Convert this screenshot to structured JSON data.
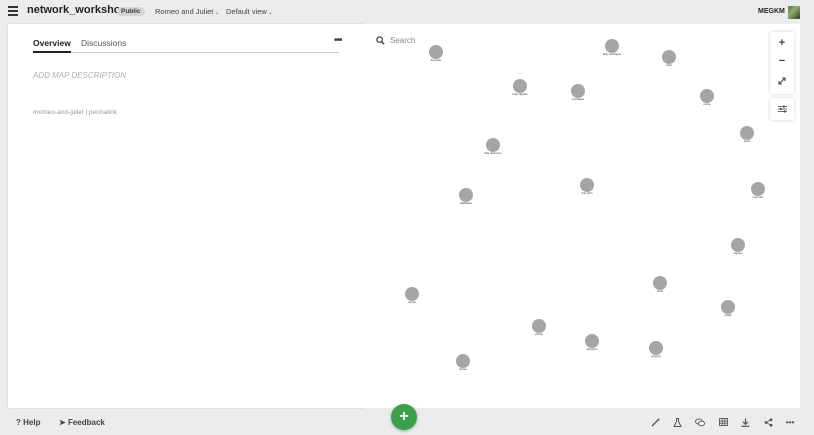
{
  "header": {
    "project_title": "network_workshop",
    "visibility_badge": "Public",
    "map_name": "Romeo and Juliet",
    "view_name": "Default view",
    "user_name": "MEGKM"
  },
  "sidebar": {
    "tabs": [
      {
        "label": "Overview",
        "active": true
      },
      {
        "label": "Discussions",
        "active": false
      }
    ],
    "description_placeholder": "ADD MAP DESCRIPTION",
    "tag": "#romeo-and-juliet",
    "separator": "|",
    "permalink": "permalink"
  },
  "map": {
    "search_placeholder": "Search",
    "node_color": "#a5a5a5",
    "nodes": [
      {
        "label": "benvolio"
      },
      {
        "label": "lady montague"
      },
      {
        "label": "juliet"
      },
      {
        "label": "lady capulet"
      },
      {
        "label": "montague"
      },
      {
        "label": "nurse"
      },
      {
        "label": "peter"
      },
      {
        "label": "friar lawrence"
      },
      {
        "label": "friar john"
      },
      {
        "label": "balthasar"
      },
      {
        "label": "mercutio"
      },
      {
        "label": "capulet"
      },
      {
        "label": "paris"
      },
      {
        "label": "romeo"
      },
      {
        "label": "tybalt"
      },
      {
        "label": "prince"
      },
      {
        "label": "sampson"
      },
      {
        "label": "gregory"
      },
      {
        "label": "citizen"
      },
      {
        "label": "page"
      }
    ]
  },
  "footer": {
    "help_label": "Help",
    "feedback_label": "Feedback",
    "add_button_color": "#3aa14a"
  },
  "toolbar": {
    "tools": [
      "wand-icon",
      "flask-icon",
      "chat-icon",
      "table-icon",
      "download-icon",
      "share-icon",
      "more-icon"
    ]
  }
}
